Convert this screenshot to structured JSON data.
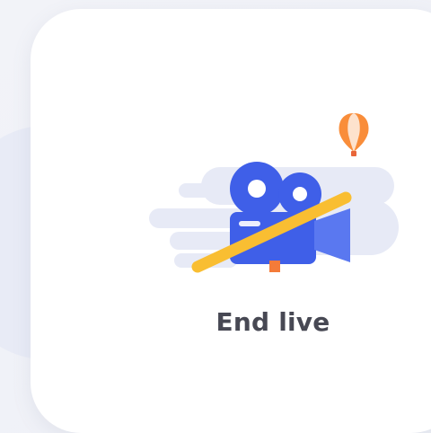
{
  "action_card": {
    "label": "End live",
    "illustration_icon": "video-camera-off-icon",
    "balloon_icon": "hot-air-balloon-icon"
  },
  "colors": {
    "card_background": "#ffffff",
    "page_background": "#f2f3f8",
    "label_text": "#474853",
    "camera_blue": "#3f5fe8",
    "strike_yellow": "#f9be32",
    "speed_lines": "#e7eaf6"
  }
}
